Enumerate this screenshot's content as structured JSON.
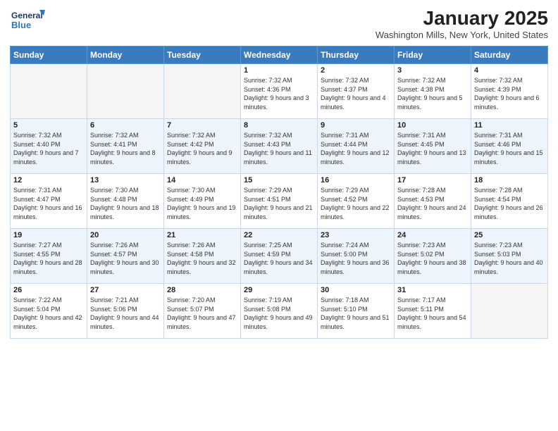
{
  "header": {
    "logo_line1": "General",
    "logo_line2": "Blue",
    "month_year": "January 2025",
    "location": "Washington Mills, New York, United States"
  },
  "days_of_week": [
    "Sunday",
    "Monday",
    "Tuesday",
    "Wednesday",
    "Thursday",
    "Friday",
    "Saturday"
  ],
  "weeks": [
    [
      {
        "day": "",
        "content": ""
      },
      {
        "day": "",
        "content": ""
      },
      {
        "day": "",
        "content": ""
      },
      {
        "day": "1",
        "content": "Sunrise: 7:32 AM\nSunset: 4:36 PM\nDaylight: 9 hours and 3 minutes."
      },
      {
        "day": "2",
        "content": "Sunrise: 7:32 AM\nSunset: 4:37 PM\nDaylight: 9 hours and 4 minutes."
      },
      {
        "day": "3",
        "content": "Sunrise: 7:32 AM\nSunset: 4:38 PM\nDaylight: 9 hours and 5 minutes."
      },
      {
        "day": "4",
        "content": "Sunrise: 7:32 AM\nSunset: 4:39 PM\nDaylight: 9 hours and 6 minutes."
      }
    ],
    [
      {
        "day": "5",
        "content": "Sunrise: 7:32 AM\nSunset: 4:40 PM\nDaylight: 9 hours and 7 minutes."
      },
      {
        "day": "6",
        "content": "Sunrise: 7:32 AM\nSunset: 4:41 PM\nDaylight: 9 hours and 8 minutes."
      },
      {
        "day": "7",
        "content": "Sunrise: 7:32 AM\nSunset: 4:42 PM\nDaylight: 9 hours and 9 minutes."
      },
      {
        "day": "8",
        "content": "Sunrise: 7:32 AM\nSunset: 4:43 PM\nDaylight: 9 hours and 11 minutes."
      },
      {
        "day": "9",
        "content": "Sunrise: 7:31 AM\nSunset: 4:44 PM\nDaylight: 9 hours and 12 minutes."
      },
      {
        "day": "10",
        "content": "Sunrise: 7:31 AM\nSunset: 4:45 PM\nDaylight: 9 hours and 13 minutes."
      },
      {
        "day": "11",
        "content": "Sunrise: 7:31 AM\nSunset: 4:46 PM\nDaylight: 9 hours and 15 minutes."
      }
    ],
    [
      {
        "day": "12",
        "content": "Sunrise: 7:31 AM\nSunset: 4:47 PM\nDaylight: 9 hours and 16 minutes."
      },
      {
        "day": "13",
        "content": "Sunrise: 7:30 AM\nSunset: 4:48 PM\nDaylight: 9 hours and 18 minutes."
      },
      {
        "day": "14",
        "content": "Sunrise: 7:30 AM\nSunset: 4:49 PM\nDaylight: 9 hours and 19 minutes."
      },
      {
        "day": "15",
        "content": "Sunrise: 7:29 AM\nSunset: 4:51 PM\nDaylight: 9 hours and 21 minutes."
      },
      {
        "day": "16",
        "content": "Sunrise: 7:29 AM\nSunset: 4:52 PM\nDaylight: 9 hours and 22 minutes."
      },
      {
        "day": "17",
        "content": "Sunrise: 7:28 AM\nSunset: 4:53 PM\nDaylight: 9 hours and 24 minutes."
      },
      {
        "day": "18",
        "content": "Sunrise: 7:28 AM\nSunset: 4:54 PM\nDaylight: 9 hours and 26 minutes."
      }
    ],
    [
      {
        "day": "19",
        "content": "Sunrise: 7:27 AM\nSunset: 4:55 PM\nDaylight: 9 hours and 28 minutes."
      },
      {
        "day": "20",
        "content": "Sunrise: 7:26 AM\nSunset: 4:57 PM\nDaylight: 9 hours and 30 minutes."
      },
      {
        "day": "21",
        "content": "Sunrise: 7:26 AM\nSunset: 4:58 PM\nDaylight: 9 hours and 32 minutes."
      },
      {
        "day": "22",
        "content": "Sunrise: 7:25 AM\nSunset: 4:59 PM\nDaylight: 9 hours and 34 minutes."
      },
      {
        "day": "23",
        "content": "Sunrise: 7:24 AM\nSunset: 5:00 PM\nDaylight: 9 hours and 36 minutes."
      },
      {
        "day": "24",
        "content": "Sunrise: 7:23 AM\nSunset: 5:02 PM\nDaylight: 9 hours and 38 minutes."
      },
      {
        "day": "25",
        "content": "Sunrise: 7:23 AM\nSunset: 5:03 PM\nDaylight: 9 hours and 40 minutes."
      }
    ],
    [
      {
        "day": "26",
        "content": "Sunrise: 7:22 AM\nSunset: 5:04 PM\nDaylight: 9 hours and 42 minutes."
      },
      {
        "day": "27",
        "content": "Sunrise: 7:21 AM\nSunset: 5:06 PM\nDaylight: 9 hours and 44 minutes."
      },
      {
        "day": "28",
        "content": "Sunrise: 7:20 AM\nSunset: 5:07 PM\nDaylight: 9 hours and 47 minutes."
      },
      {
        "day": "29",
        "content": "Sunrise: 7:19 AM\nSunset: 5:08 PM\nDaylight: 9 hours and 49 minutes."
      },
      {
        "day": "30",
        "content": "Sunrise: 7:18 AM\nSunset: 5:10 PM\nDaylight: 9 hours and 51 minutes."
      },
      {
        "day": "31",
        "content": "Sunrise: 7:17 AM\nSunset: 5:11 PM\nDaylight: 9 hours and 54 minutes."
      },
      {
        "day": "",
        "content": ""
      }
    ]
  ]
}
